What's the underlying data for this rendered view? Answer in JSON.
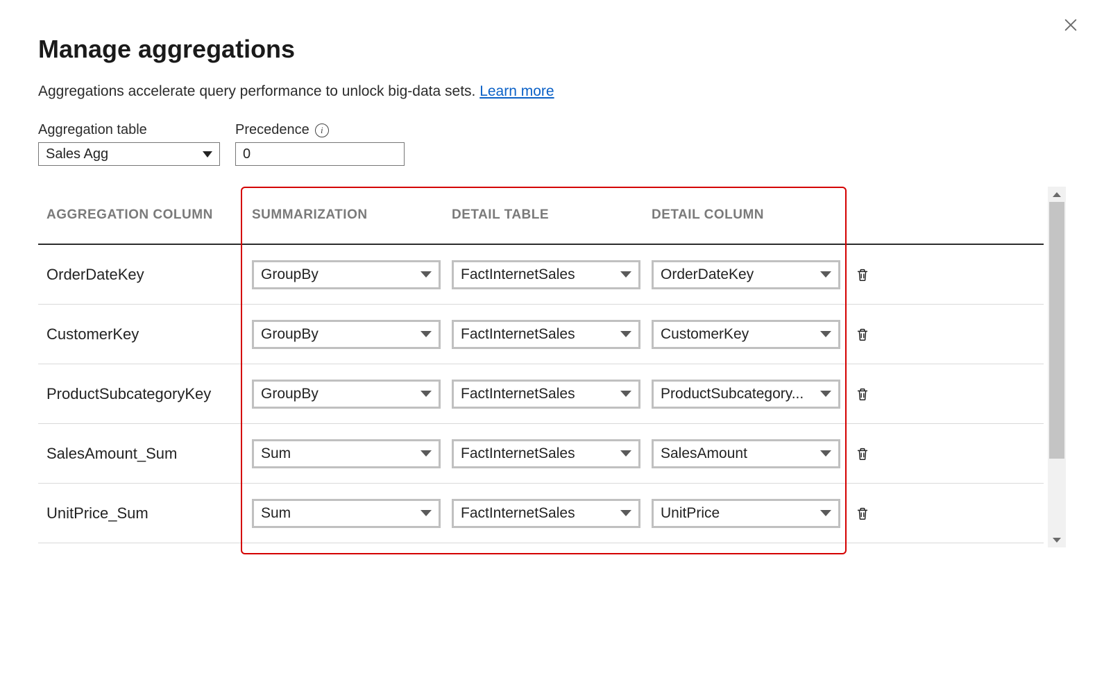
{
  "dialog": {
    "title": "Manage aggregations",
    "description": "Aggregations accelerate query performance to unlock big-data sets.",
    "learn_more": "Learn more"
  },
  "controls": {
    "agg_table_label": "Aggregation table",
    "agg_table_value": "Sales Agg",
    "precedence_label": "Precedence",
    "precedence_value": "0"
  },
  "headers": {
    "agg_col": "AGGREGATION COLUMN",
    "summarization": "SUMMARIZATION",
    "detail_table": "DETAIL TABLE",
    "detail_column": "DETAIL COLUMN"
  },
  "rows": [
    {
      "agg_col": "OrderDateKey",
      "summarization": "GroupBy",
      "detail_table": "FactInternetSales",
      "detail_column": "OrderDateKey"
    },
    {
      "agg_col": "CustomerKey",
      "summarization": "GroupBy",
      "detail_table": "FactInternetSales",
      "detail_column": "CustomerKey"
    },
    {
      "agg_col": "ProductSubcategoryKey",
      "summarization": "GroupBy",
      "detail_table": "FactInternetSales",
      "detail_column": "ProductSubcategory..."
    },
    {
      "agg_col": "SalesAmount_Sum",
      "summarization": "Sum",
      "detail_table": "FactInternetSales",
      "detail_column": "SalesAmount"
    },
    {
      "agg_col": "UnitPrice_Sum",
      "summarization": "Sum",
      "detail_table": "FactInternetSales",
      "detail_column": "UnitPrice"
    }
  ]
}
